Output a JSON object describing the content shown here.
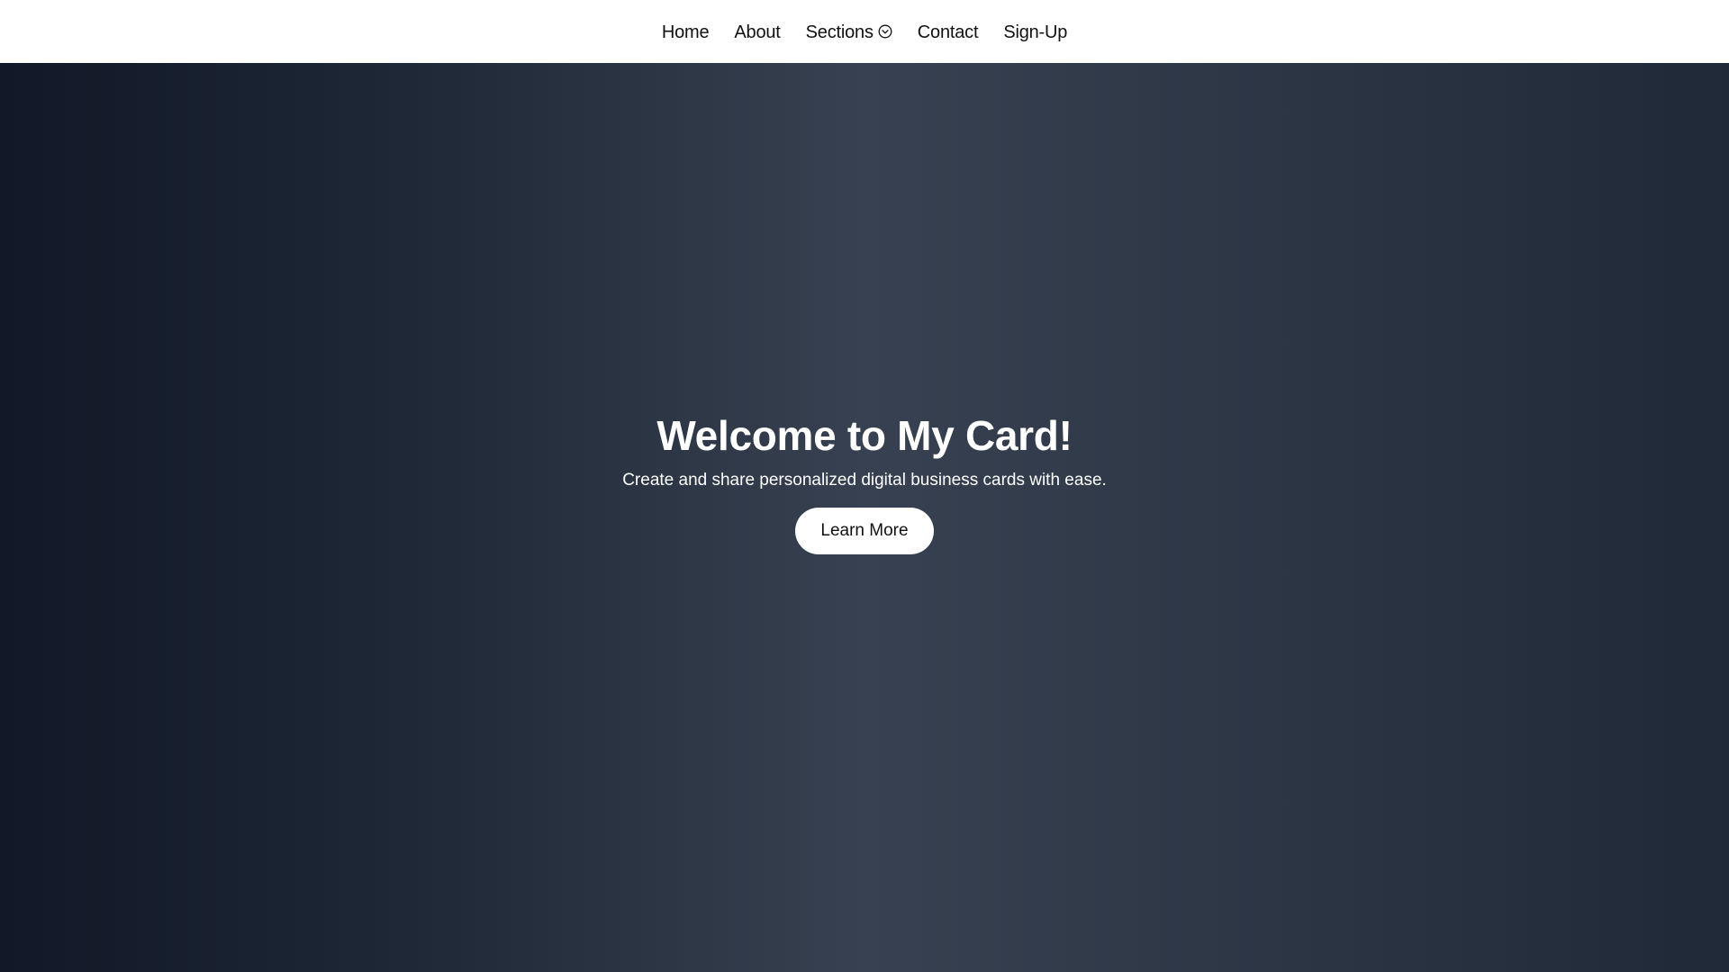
{
  "nav": {
    "items": [
      {
        "label": "Home"
      },
      {
        "label": "About"
      },
      {
        "label": "Sections",
        "icon": "chevron-down-circle-icon"
      },
      {
        "label": "Contact"
      },
      {
        "label": "Sign-Up"
      }
    ]
  },
  "hero": {
    "title": "Welcome to My Card!",
    "subtitle": "Create and share personalized digital business cards with ease.",
    "button_label": "Learn More"
  },
  "colors": {
    "nav_background": "#ffffff",
    "hero_gradient_dark": "#111827",
    "hero_gradient_mid": "#1f2937",
    "hero_gradient_light": "#374151",
    "text_light": "#ffffff",
    "text_dark": "#111111"
  }
}
